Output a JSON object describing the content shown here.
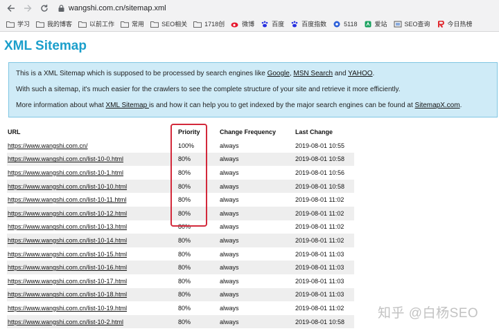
{
  "browser": {
    "url": "wangshi.com.cn/sitemap.xml",
    "bookmarks": [
      {
        "label": "学习",
        "icon": "folder-icon"
      },
      {
        "label": "我的博客",
        "icon": "folder-icon"
      },
      {
        "label": "以前工作",
        "icon": "folder-icon"
      },
      {
        "label": "常用",
        "icon": "folder-icon"
      },
      {
        "label": "SEO相关",
        "icon": "folder-icon"
      },
      {
        "label": "1718创",
        "icon": "folder-icon"
      },
      {
        "label": "微博",
        "icon": "weibo-icon"
      },
      {
        "label": "百度",
        "icon": "baidu-paw-icon"
      },
      {
        "label": "百度指数",
        "icon": "baidu-paw-icon"
      },
      {
        "label": "5118",
        "icon": "5118-icon"
      },
      {
        "label": "爱站",
        "icon": "aizhan-icon"
      },
      {
        "label": "SEO查询",
        "icon": "seo-query-icon"
      },
      {
        "label": "今日热榜",
        "icon": "rebang-icon"
      }
    ]
  },
  "page": {
    "title": "XML Sitemap",
    "intro": {
      "line1_prefix": "This is a XML Sitemap which is supposed to be processed by search engines like ",
      "google": "Google",
      "comma": ", ",
      "msn": "MSN Search",
      "and": " and ",
      "yahoo": "YAHOO",
      "period": ".",
      "line2": "With such a sitemap, it's much easier for the crawlers to see the complete structure of your site and retrieve it more efficiently.",
      "line3_prefix": "More information about what ",
      "xml_sitemap": "XML Sitemap ",
      "line3_mid": "is and how it can help you to get indexed by the major search engines can be found at ",
      "sitemapx": "SitemapX.com",
      "line3_end": "."
    },
    "table": {
      "headers": {
        "url": "URL",
        "priority": "Priority",
        "frequency": "Change Frequency",
        "last": "Last Change"
      },
      "rows": [
        {
          "url": "https://www.wangshi.com.cn/",
          "priority": "100%",
          "frequency": "always",
          "last": "2019-08-01 10:55"
        },
        {
          "url": "https://www.wangshi.com.cn/list-10-0.html",
          "priority": "80%",
          "frequency": "always",
          "last": "2019-08-01 10:58"
        },
        {
          "url": "https://www.wangshi.com.cn/list-10-1.html",
          "priority": "80%",
          "frequency": "always",
          "last": "2019-08-01 10:56"
        },
        {
          "url": "https://www.wangshi.com.cn/list-10-10.html",
          "priority": "80%",
          "frequency": "always",
          "last": "2019-08-01 10:58"
        },
        {
          "url": "https://www.wangshi.com.cn/list-10-11.html",
          "priority": "80%",
          "frequency": "always",
          "last": "2019-08-01 11:02"
        },
        {
          "url": "https://www.wangshi.com.cn/list-10-12.html",
          "priority": "80%",
          "frequency": "always",
          "last": "2019-08-01 11:02"
        },
        {
          "url": "https://www.wangshi.com.cn/list-10-13.html",
          "priority": "80%",
          "frequency": "always",
          "last": "2019-08-01 11:02"
        },
        {
          "url": "https://www.wangshi.com.cn/list-10-14.html",
          "priority": "80%",
          "frequency": "always",
          "last": "2019-08-01 11:02"
        },
        {
          "url": "https://www.wangshi.com.cn/list-10-15.html",
          "priority": "80%",
          "frequency": "always",
          "last": "2019-08-01 11:03"
        },
        {
          "url": "https://www.wangshi.com.cn/list-10-16.html",
          "priority": "80%",
          "frequency": "always",
          "last": "2019-08-01 11:03"
        },
        {
          "url": "https://www.wangshi.com.cn/list-10-17.html",
          "priority": "80%",
          "frequency": "always",
          "last": "2019-08-01 11:03"
        },
        {
          "url": "https://www.wangshi.com.cn/list-10-18.html",
          "priority": "80%",
          "frequency": "always",
          "last": "2019-08-01 11:03"
        },
        {
          "url": "https://www.wangshi.com.cn/list-10-19.html",
          "priority": "80%",
          "frequency": "always",
          "last": "2019-08-01 11:02"
        },
        {
          "url": "https://www.wangshi.com.cn/list-10-2.html",
          "priority": "80%",
          "frequency": "always",
          "last": "2019-08-01 10:58"
        }
      ]
    },
    "highlight_color": "#d3283a",
    "accent_color": "#1b9fcb"
  },
  "watermark": "知乎 @白杨SEO"
}
